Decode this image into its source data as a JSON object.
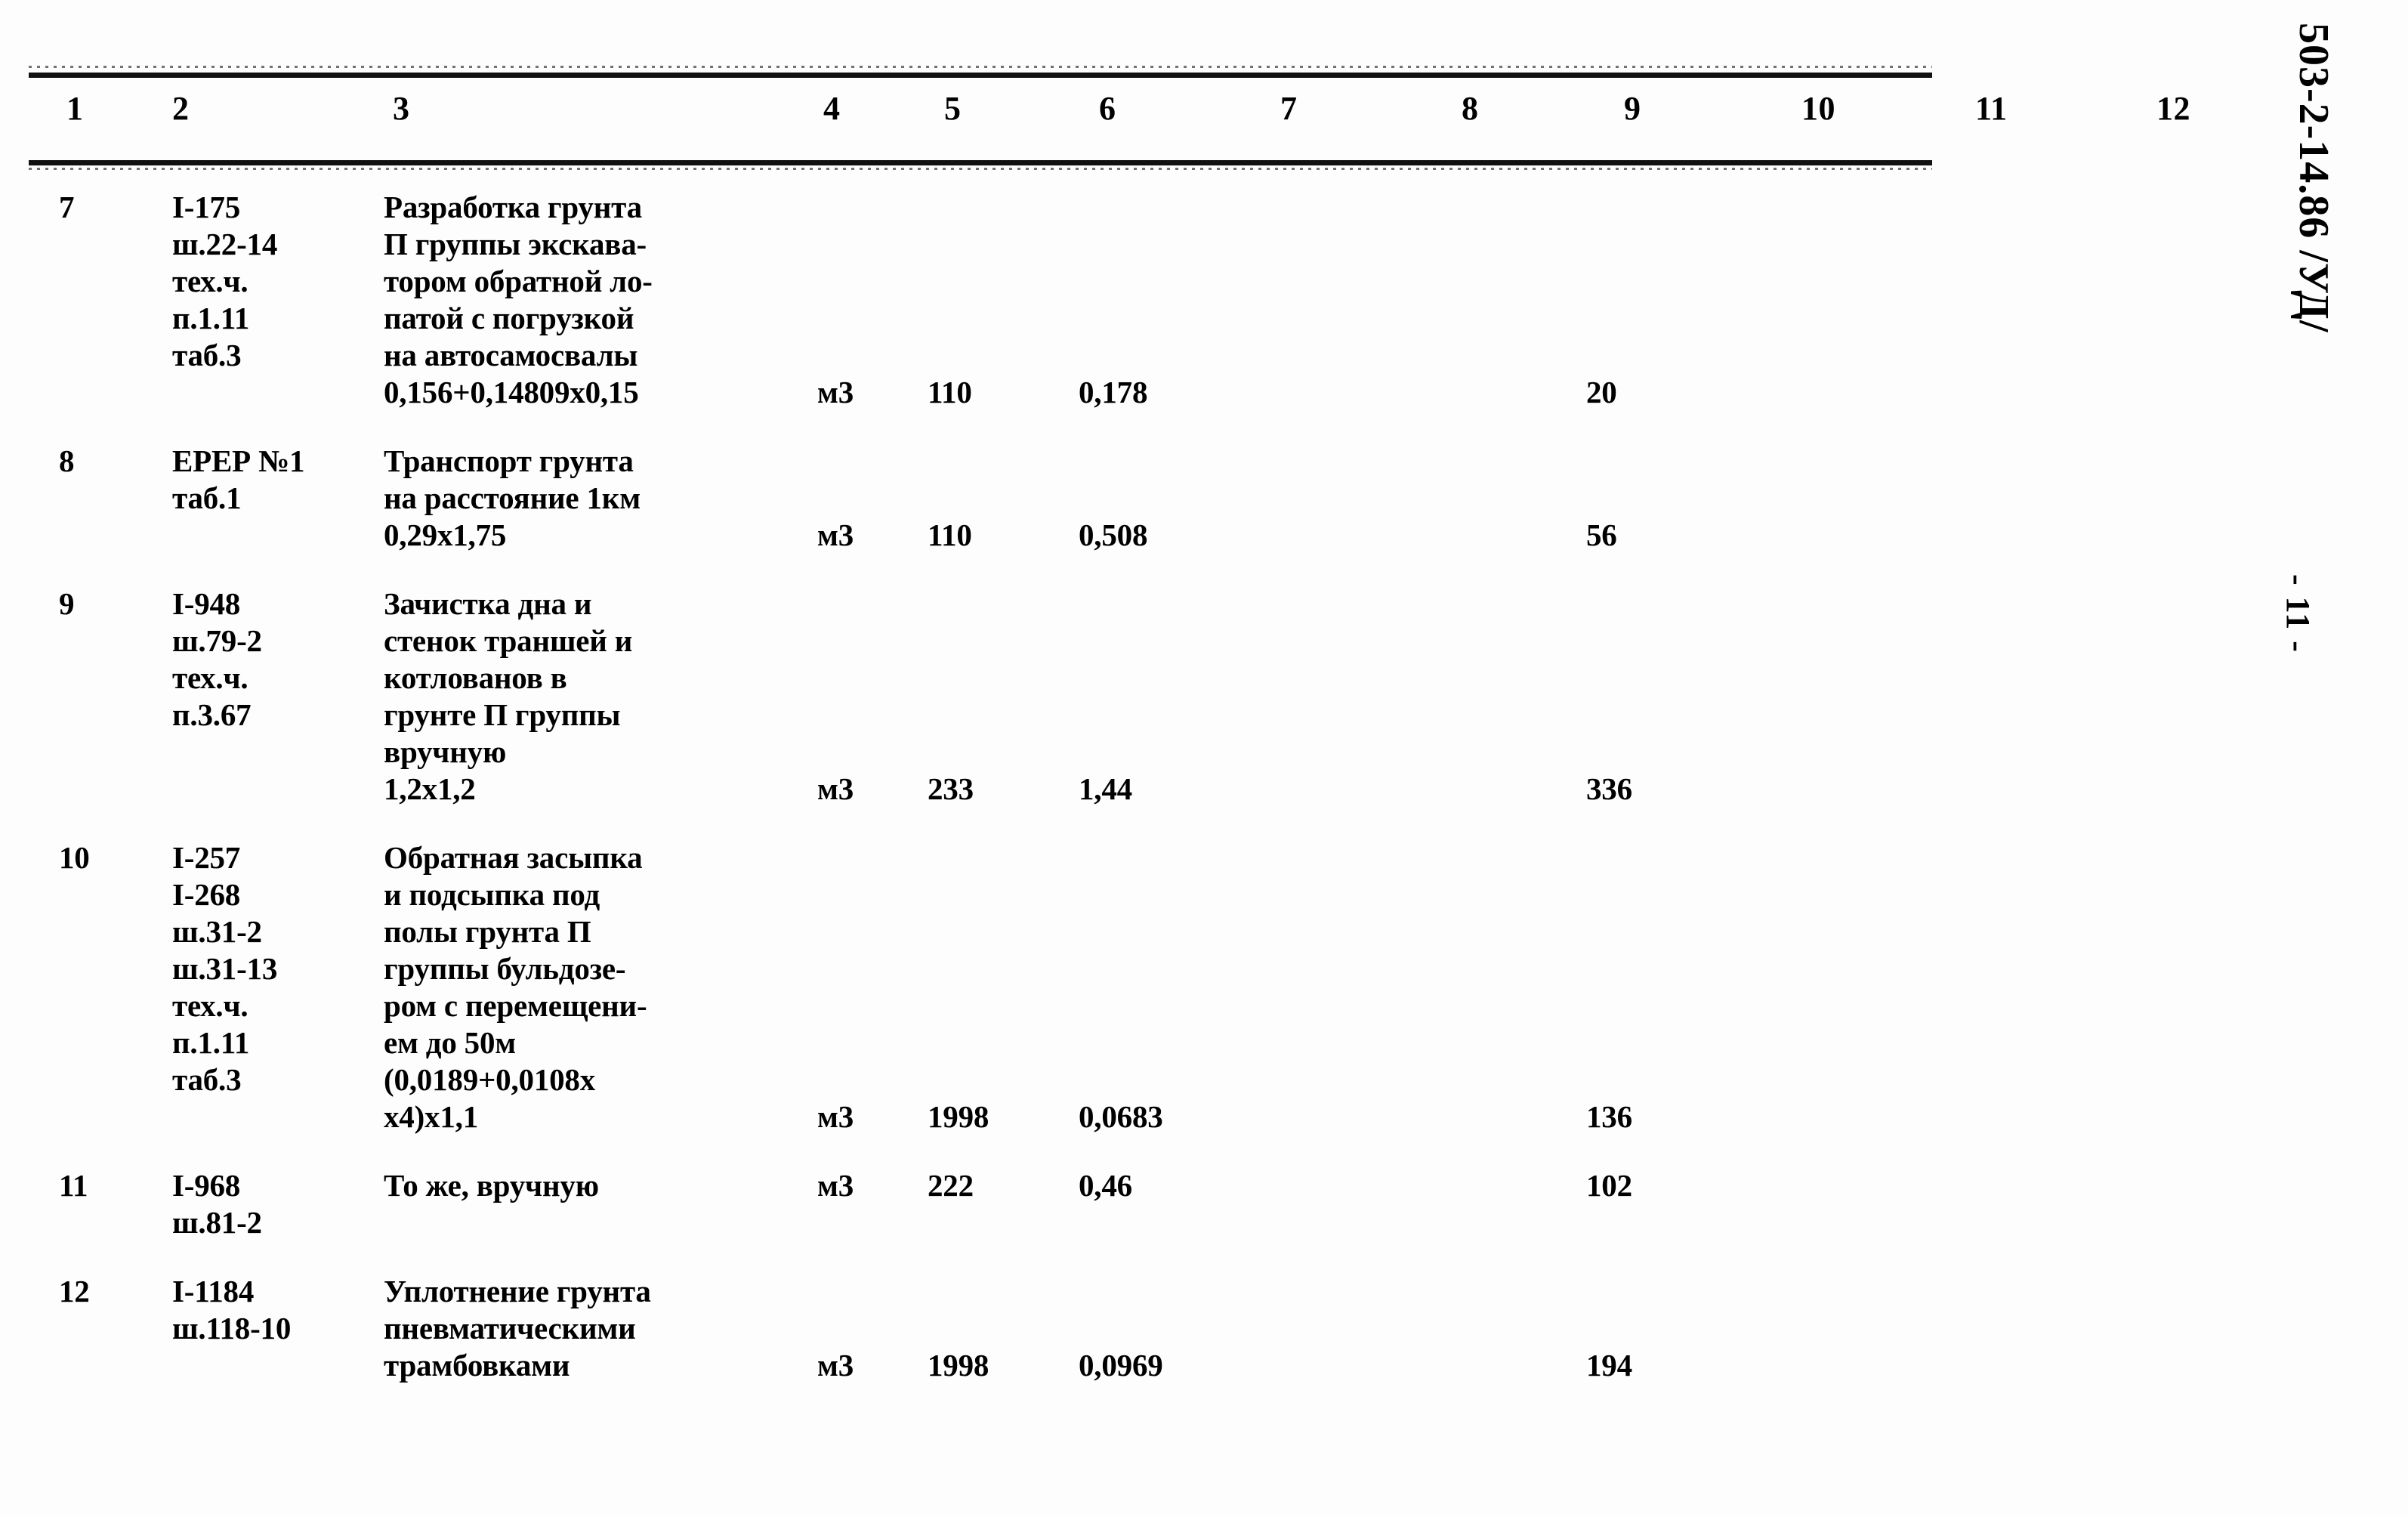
{
  "document": {
    "code_stamp": "503-2-14.86  /УД/",
    "page_label": "- 11 -"
  },
  "table": {
    "column_headers": [
      "1",
      "2",
      "3",
      "4",
      "5",
      "6",
      "7",
      "8",
      "9",
      "10",
      "11",
      "12"
    ],
    "rows": [
      {
        "num": "7",
        "code_lines": [
          "I-175",
          "ш.22-14",
          "тех.ч.",
          "п.1.11",
          "таб.3"
        ],
        "desc_lines": [
          "Разработка грунта",
          "П группы экскава-",
          "тором обратной ло-",
          "патой с погрузкой",
          "на автосамосвалы",
          "0,156+0,14809х0,15"
        ],
        "unit": "м3",
        "quantity": "110",
        "price": "0,178",
        "total": "20"
      },
      {
        "num": "8",
        "code_lines": [
          "ЕРЕР №1",
          "таб.1"
        ],
        "desc_lines": [
          "Транспорт грунта",
          "на расстояние 1км",
          "0,29х1,75"
        ],
        "unit": "м3",
        "quantity": "110",
        "price": "0,508",
        "total": "56"
      },
      {
        "num": "9",
        "code_lines": [
          "I-948",
          "ш.79-2",
          "тех.ч.",
          "п.3.67"
        ],
        "desc_lines": [
          "Зачистка дна и",
          "стенок траншей и",
          "котлованов в",
          "грунте П группы",
          "вручную",
          "1,2х1,2"
        ],
        "unit": "м3",
        "quantity": "233",
        "price": "1,44",
        "total": "336"
      },
      {
        "num": "10",
        "code_lines": [
          "I-257",
          "I-268",
          "ш.31-2",
          "ш.31-13",
          "тех.ч.",
          "п.1.11",
          "таб.3"
        ],
        "desc_lines": [
          "Обратная засыпка",
          "и подсыпка под",
          "полы грунта П",
          "группы бульдозе-",
          "ром с перемещени-",
          "ем до 50м",
          "(0,0189+0,0108х",
          "х4)х1,1"
        ],
        "unit": "м3",
        "quantity": "1998",
        "price": "0,0683",
        "total": "136"
      },
      {
        "num": "11",
        "code_lines": [
          "I-968",
          "ш.81-2"
        ],
        "desc_lines": [
          "То же, вручную"
        ],
        "unit": "м3",
        "quantity": "222",
        "price": "0,46",
        "total": "102"
      },
      {
        "num": "12",
        "code_lines": [
          "I-1184",
          "ш.118-10"
        ],
        "desc_lines": [
          "Уплотнение грунта",
          "пневматическими",
          "трамбовками"
        ],
        "unit": "м3",
        "quantity": "1998",
        "price": "0,0969",
        "total": "194"
      }
    ]
  }
}
